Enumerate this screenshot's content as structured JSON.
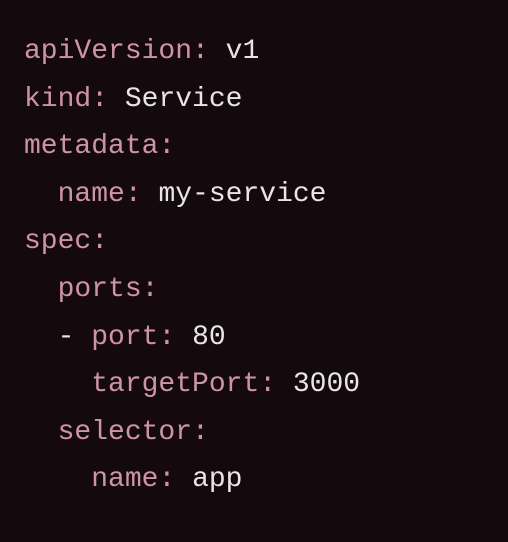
{
  "yaml": {
    "apiVersion": {
      "key": "apiVersion",
      "value": "v1"
    },
    "kind": {
      "key": "kind",
      "value": "Service"
    },
    "metadata": {
      "key": "metadata"
    },
    "metadata_name": {
      "key": "name",
      "value": "my-service"
    },
    "spec": {
      "key": "spec"
    },
    "ports": {
      "key": "ports"
    },
    "port": {
      "key": "port",
      "value": "80"
    },
    "targetPort": {
      "key": "targetPort",
      "value": "3000"
    },
    "selector": {
      "key": "selector"
    },
    "selector_name": {
      "key": "name",
      "value": "app"
    },
    "dash": "-"
  }
}
